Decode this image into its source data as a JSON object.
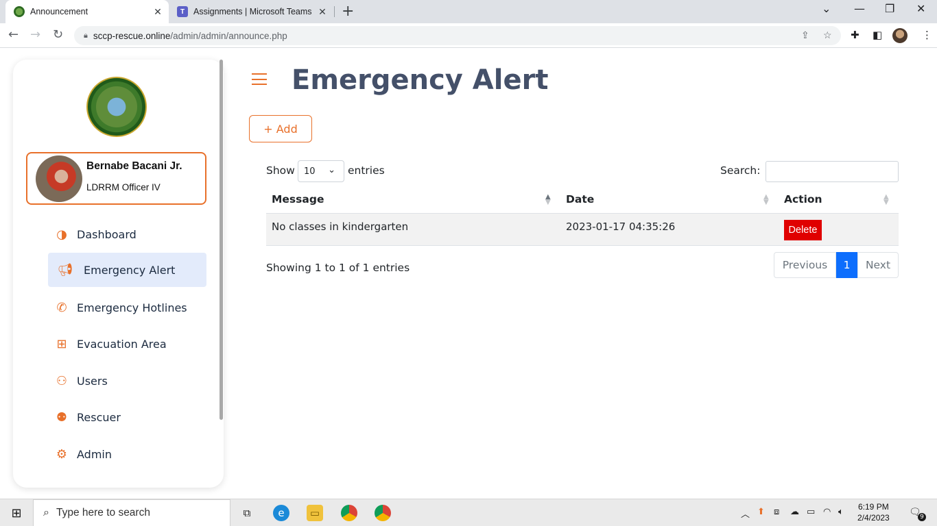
{
  "browser": {
    "tabs": [
      {
        "title": "Announcement",
        "close": "✕"
      },
      {
        "title": "Assignments | Microsoft Teams",
        "close": "✕"
      }
    ],
    "new_tab": "+",
    "url_host": "sccp-rescue.online",
    "url_path": "/admin/admin/announce.php"
  },
  "sidebar": {
    "user_name": "Bernabe Bacani Jr.",
    "user_role": "LDRRM Officer IV",
    "items": [
      {
        "label": "Dashboard",
        "icon": "contrast-icon"
      },
      {
        "label": "Emergency Alert",
        "icon": "megaphone-icon",
        "active": true
      },
      {
        "label": "Emergency Hotlines",
        "icon": "phone-icon"
      },
      {
        "label": "Evacuation Area",
        "icon": "first-aid-icon"
      },
      {
        "label": "Users",
        "icon": "users-icon"
      },
      {
        "label": "Rescuer",
        "icon": "user-gear-icon"
      },
      {
        "label": "Admin",
        "icon": "admin-gear-icon"
      }
    ]
  },
  "main": {
    "title": "Emergency Alert",
    "add_label": "+ Add",
    "show_label": "Show",
    "entries_value": "10",
    "entries_label": "entries",
    "search_label": "Search:",
    "columns": [
      "Message",
      "Date",
      "Action"
    ],
    "rows": [
      {
        "message": "No classes in kindergarten",
        "date": "2023-01-17 04:35:26",
        "action": "Delete"
      }
    ],
    "info": "Showing 1 to 1 of 1 entries",
    "pagination": {
      "previous": "Previous",
      "current": "1",
      "next": "Next"
    }
  },
  "taskbar": {
    "search_placeholder": "Type here to search",
    "time": "6:19 PM",
    "date": "2/4/2023",
    "notification_count": "9"
  },
  "colors": {
    "accent": "#e8702a",
    "title": "#445069",
    "delete": "#e00000",
    "page_active": "#0d6efd",
    "menu_active_bg": "#e3ebfb"
  }
}
